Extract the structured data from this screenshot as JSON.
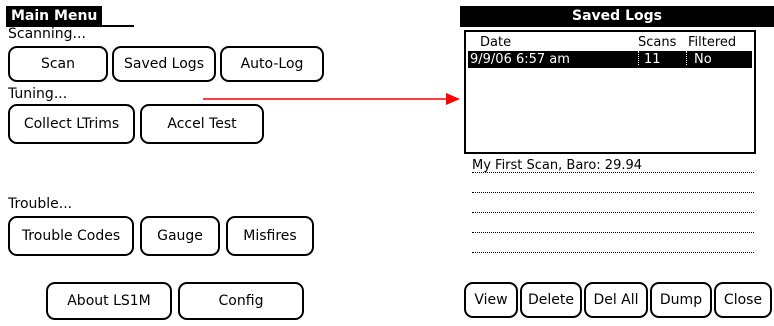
{
  "main_menu": {
    "title": "Main Menu",
    "sections": {
      "scanning": "Scanning...",
      "tuning": "Tuning...",
      "trouble": "Trouble..."
    },
    "buttons": {
      "scan": "Scan",
      "saved_logs": "Saved Logs",
      "auto_log": "Auto-Log",
      "collect_ltrims": "Collect LTrims",
      "accel_test": "Accel Test",
      "trouble_codes": "Trouble Codes",
      "gauge": "Gauge",
      "misfires": "Misfires",
      "about": "About LS1M",
      "config": "Config"
    }
  },
  "saved_logs": {
    "title": "Saved Logs",
    "columns": [
      "Date",
      "Scans",
      "Filtered"
    ],
    "rows": [
      {
        "date": "9/9/06 6:57 am",
        "scans": "11",
        "filtered": "No",
        "selected": true
      }
    ],
    "note": "My First Scan, Baro: 29.94",
    "buttons": {
      "view": "View",
      "delete": "Delete",
      "del_all": "Del All",
      "dump": "Dump",
      "close": "Close"
    }
  },
  "annotation": {
    "arrow_color": "#ff0000"
  }
}
